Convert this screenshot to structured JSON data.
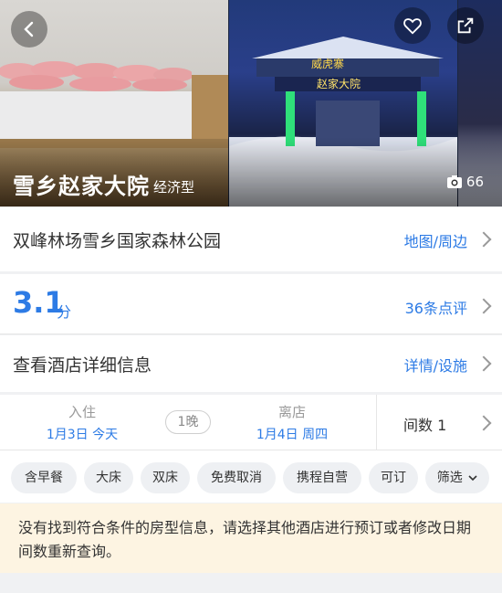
{
  "header": {
    "hotel_name": "雪乡赵家大院",
    "hotel_tier": "经济型",
    "photo_count": "66",
    "sign_text_1": "威虎寨",
    "sign_text_2": "赵家大院"
  },
  "location": {
    "address": "双峰林场雪乡国家森林公园",
    "map_link": "地图/周边"
  },
  "rating": {
    "score": "3.1",
    "unit": "分",
    "reviews_link": "36条点评"
  },
  "details": {
    "label": "查看酒店详细信息",
    "link": "详情/设施"
  },
  "booking": {
    "checkin_label": "入住",
    "checkin_date": "1月3日 今天",
    "nights": "1晚",
    "checkout_label": "离店",
    "checkout_date": "1月4日 周四",
    "rooms": "间数 1"
  },
  "filters": [
    {
      "label": "含早餐"
    },
    {
      "label": "大床"
    },
    {
      "label": "双床"
    },
    {
      "label": "免费取消"
    },
    {
      "label": "携程自营"
    },
    {
      "label": "可订"
    },
    {
      "label": "筛选"
    }
  ],
  "notice": {
    "text": "没有找到符合条件的房型信息，请选择其他酒店进行预订或者修改日期间数重新查询。"
  },
  "colors": {
    "accent": "#2d7be5",
    "notice_bg": "#fdf4e2"
  }
}
